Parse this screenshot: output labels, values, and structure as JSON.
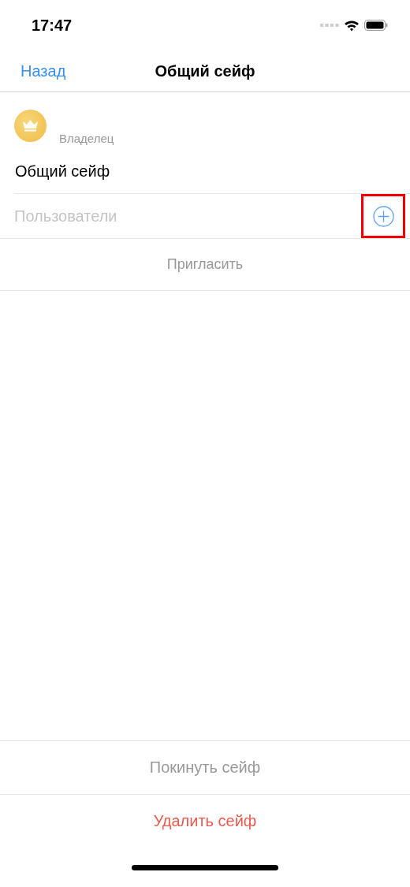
{
  "status_bar": {
    "time": "17:47"
  },
  "nav": {
    "back": "Назад",
    "title": "Общий сейф"
  },
  "owner": {
    "role": "Владелец",
    "vault_name": "Общий сейф"
  },
  "users": {
    "placeholder": "Пользователи",
    "add_highlighted": true
  },
  "invite": "Пригласить",
  "actions": [
    {
      "label": "Покинуть сейф",
      "kind": "neutral"
    },
    {
      "label": "Удалить сейф",
      "kind": "destructive"
    }
  ]
}
